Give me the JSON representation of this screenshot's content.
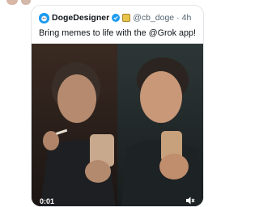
{
  "tweet": {
    "display_name": "DogeDesigner",
    "handle": "@cb_doge",
    "separator": "·",
    "time": "4h",
    "text": "Bring memes to life with the @Grok app!",
    "verified_icon": "verified-badge-icon",
    "org_badge_icon": "org-badge-icon"
  },
  "media": {
    "timestamp": "0:01",
    "mute_icon": "speaker-muted-icon"
  },
  "colors": {
    "verified": "#1d9bf0",
    "name": "#0f1419",
    "secondary": "#536471",
    "border": "#e3e6ea"
  }
}
